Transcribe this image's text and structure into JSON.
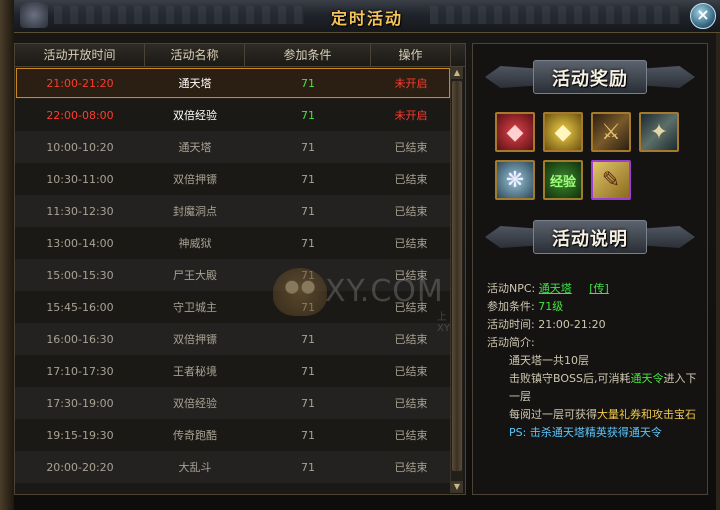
{
  "window": {
    "title": "定时活动",
    "close_glyph": "×"
  },
  "table": {
    "headers": [
      "活动开放时间",
      "活动名称",
      "参加条件",
      "操作"
    ],
    "rows": [
      {
        "time": "21:00-21:20",
        "name": "通天塔",
        "level": "71",
        "status": "未开启"
      },
      {
        "time": "22:00-08:00",
        "name": "双倍经验",
        "level": "71",
        "status": "未开启"
      },
      {
        "time": "10:00-10:20",
        "name": "通天塔",
        "level": "71",
        "status": "已结束"
      },
      {
        "time": "10:30-11:00",
        "name": "双倍押镖",
        "level": "71",
        "status": "已结束"
      },
      {
        "time": "11:30-12:30",
        "name": "封魔洞点",
        "level": "71",
        "status": "已结束"
      },
      {
        "time": "13:00-14:00",
        "name": "神威狱",
        "level": "71",
        "status": "已结束"
      },
      {
        "time": "15:00-15:30",
        "name": "尸王大殿",
        "level": "71",
        "status": "已结束"
      },
      {
        "time": "15:45-16:00",
        "name": "守卫城主",
        "level": "71",
        "status": "已结束"
      },
      {
        "time": "16:00-16:30",
        "name": "双倍押镖",
        "level": "71",
        "status": "已结束"
      },
      {
        "time": "17:10-17:30",
        "name": "王者秘境",
        "level": "71",
        "status": "已结束"
      },
      {
        "time": "17:30-19:00",
        "name": "双倍经验",
        "level": "71",
        "status": "已结束"
      },
      {
        "time": "19:15-19:30",
        "name": "传奇跑酷",
        "level": "71",
        "status": "已结束"
      },
      {
        "time": "20:00-20:20",
        "name": "大乱斗",
        "level": "71",
        "status": "已结束"
      }
    ]
  },
  "watermark": {
    "text": "XY.COM",
    "sub": "上XY"
  },
  "rewards": {
    "title": "活动奖励",
    "items": [
      {
        "icon": "red-gem-icon",
        "glyph": "◆"
      },
      {
        "icon": "gold-gem-icon",
        "glyph": "◆"
      },
      {
        "icon": "sword-icon",
        "glyph": "⚔"
      },
      {
        "icon": "spear-icon",
        "glyph": "✦"
      },
      {
        "icon": "wings-icon",
        "glyph": "❋"
      },
      {
        "icon": "exp-book-icon",
        "glyph": "经验"
      },
      {
        "icon": "scroll-icon",
        "glyph": "✎"
      }
    ]
  },
  "description": {
    "title": "活动说明",
    "npc_label": "活动NPC:",
    "npc_value": "通天塔",
    "npc_link": "[传]",
    "cond_label": "参加条件:",
    "cond_value": "71级",
    "time_label": "活动时间:",
    "time_value": "21:00-21:20",
    "intro_label": "活动简介:",
    "intro_1": "通天塔一共10层",
    "intro_2a": "击败镇守BOSS后,可消耗",
    "intro_2b": "通天令",
    "intro_2c": "进入下一层",
    "intro_3a": "每阅过一层可获得",
    "intro_3b": "大量礼券和攻击宝石",
    "ps": "PS: 击杀通天塔精英获得通天令"
  }
}
